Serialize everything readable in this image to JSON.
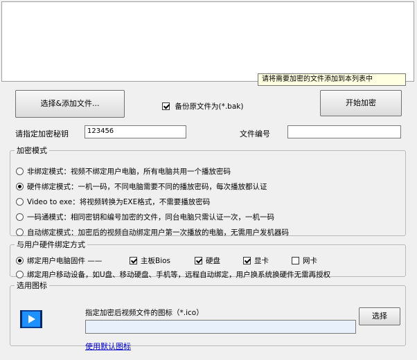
{
  "tooltip": "请将需要加密的文件添加到本列表中",
  "toolbar": {
    "add_files_label": "选择&添加文件...",
    "backup_label": "备份原文件为(*.bak)",
    "backup_checked": true,
    "start_label": "开始加密"
  },
  "key_row": {
    "key_label": "请指定加密秘钥",
    "key_value": "123456",
    "file_no_label": "文件编号",
    "file_no_value": ""
  },
  "encrypt_mode": {
    "title": "加密模式",
    "selected_index": 1,
    "options": [
      "非绑定模式：视频不绑定用户电脑，所有电脑共用一个播放密码",
      "硬件绑定模式：一机一码，不同电脑需要不同的播放密码，每次播放都认证",
      "Video to exe：将视频转换为EXE格式，不需要播放密码",
      "一码通模式：相同密钥和编号加密的文件，同台电脑只需认证一次，一机一码",
      "自动绑定模式：加密后的视频自动绑定用户第一次播放的电脑，无需用户发机器码"
    ]
  },
  "hw_binding": {
    "title": "与用户硬件绑定方式",
    "option1_label": "绑定用户电脑固件 ——",
    "option1_selected": true,
    "hw_items": [
      {
        "label": "主板Bios",
        "checked": true
      },
      {
        "label": "硬盘",
        "checked": true
      },
      {
        "label": "显卡",
        "checked": true
      },
      {
        "label": "网卡",
        "checked": false
      }
    ],
    "option2_label": "绑定用户移动设备，如U盘、移动硬盘、手机等，远程自动绑定，用户换系统换硬件无需再授权",
    "option2_selected": false
  },
  "icon_group": {
    "title": "选用图标",
    "prompt": "指定加密后视频文件的图标（*.ico）",
    "path_value": "",
    "browse_label": "选择",
    "default_link": "使用默认图标",
    "icon_name": "video-play-icon",
    "icon_color": "#1e90ff"
  }
}
